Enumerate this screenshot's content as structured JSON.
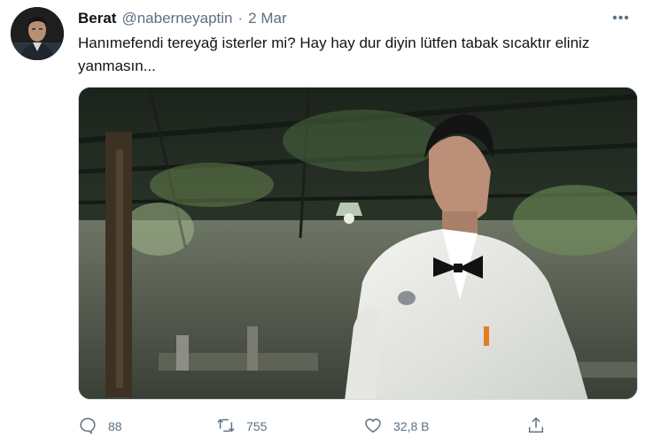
{
  "tweet": {
    "author_name": "Berat",
    "handle": "@naberneyaptin",
    "separator": "·",
    "date": "2 Mar",
    "more_label": "•••",
    "text": "Hanımefendi tereyağ isterler mi? Hay hay dur diyin lütfen tabak sıcaktır eliniz yanmasın..."
  },
  "actions": {
    "reply_count": "88",
    "retweet_count": "755",
    "like_count": "32,8 B"
  },
  "icons": {
    "reply": "reply-icon",
    "retweet": "retweet-icon",
    "like": "heart-icon",
    "share": "share-icon",
    "more": "more-icon"
  },
  "colors": {
    "text": "#0f1419",
    "muted": "#5b7083"
  }
}
